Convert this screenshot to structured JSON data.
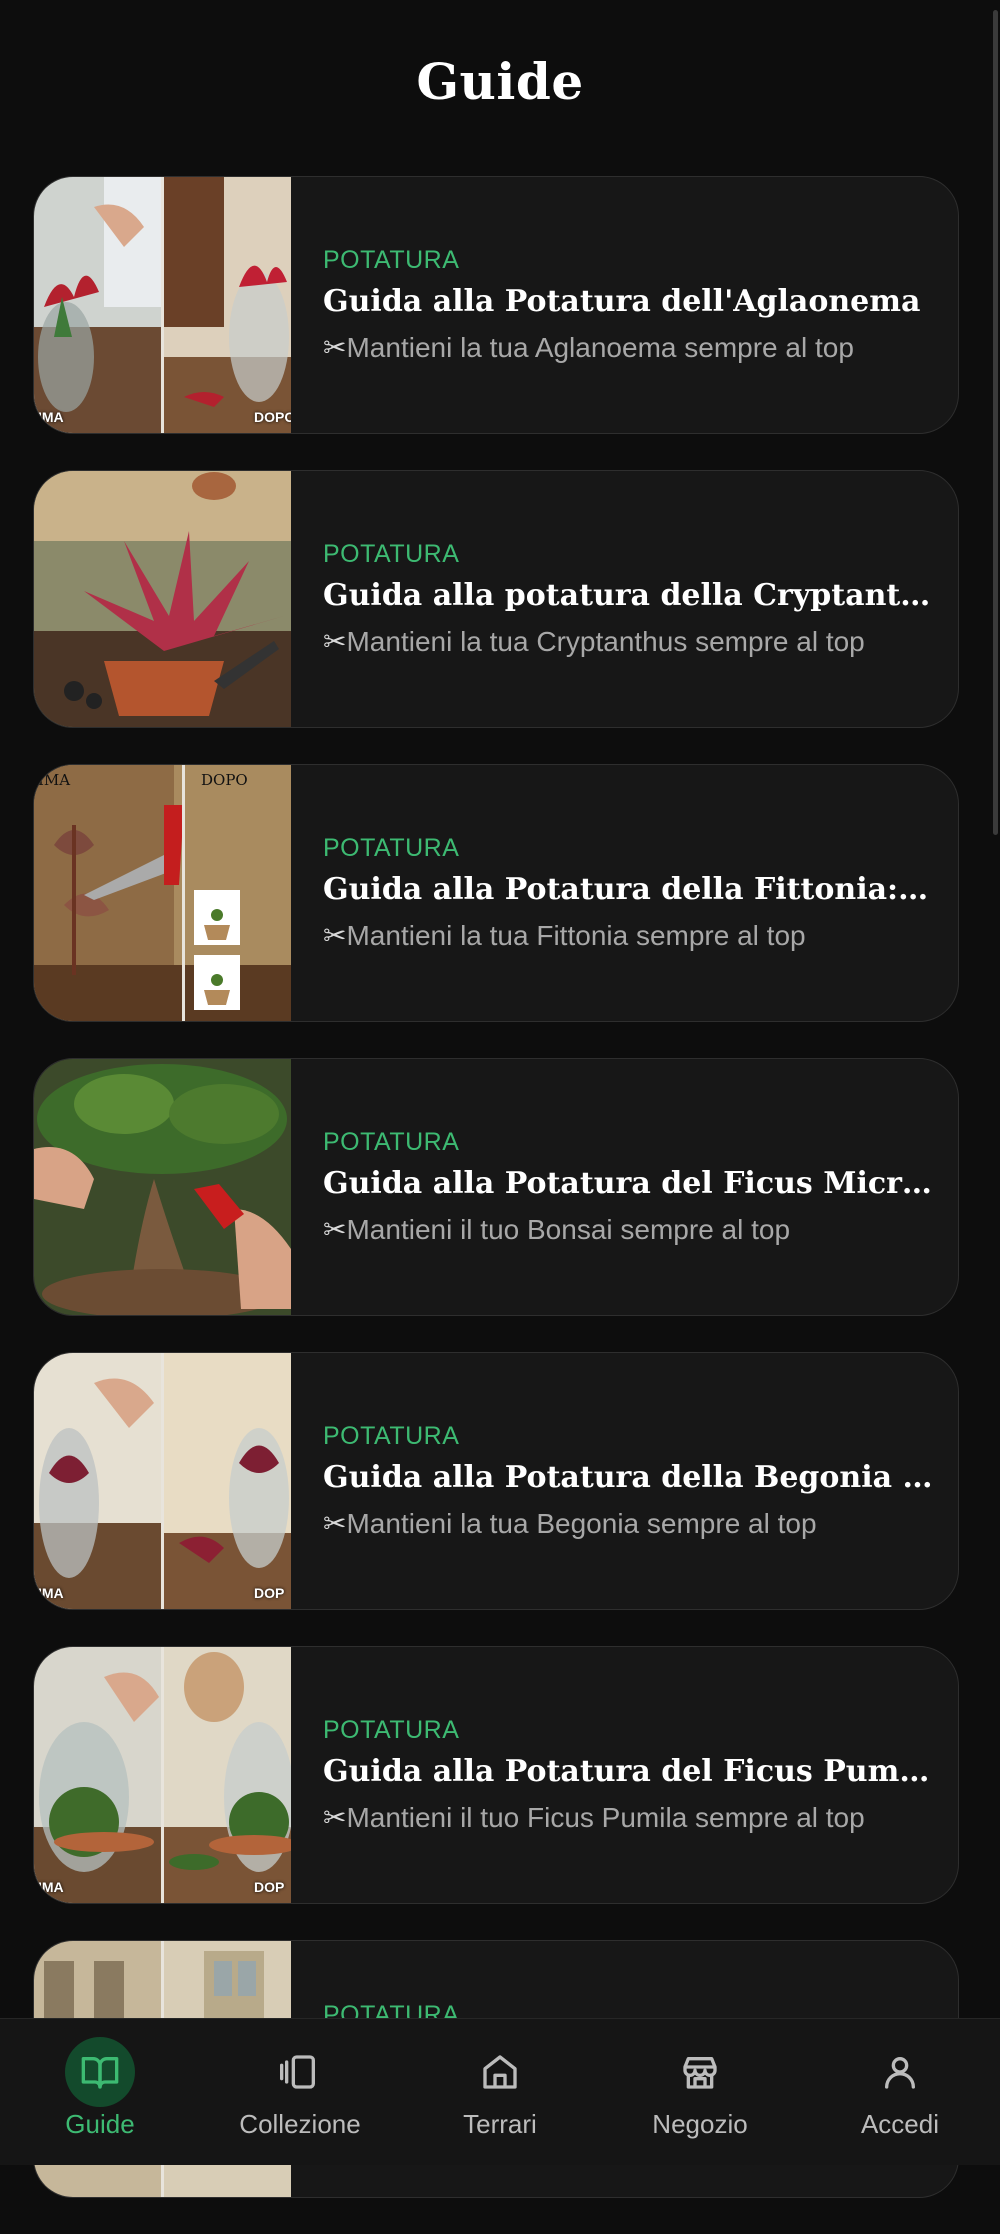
{
  "header": {
    "title": "Guide"
  },
  "colors": {
    "accent": "#3dba72",
    "background": "#0d0d0d",
    "card": "#171717"
  },
  "guides": [
    {
      "category": "POTATURA",
      "title": "Guida alla Potatura dell'Aglaonema",
      "subtitle_icon": "✂",
      "subtitle": "Mantieni la tua Aglanoema sempre al top",
      "thumb_left_tag": "IMA",
      "thumb_right_tag": "DOPO"
    },
    {
      "category": "POTATURA",
      "title": "Guida alla potatura della Cryptanthus",
      "subtitle_icon": "✂",
      "subtitle": "Mantieni la tua Cryptanthus sempre al top"
    },
    {
      "category": "POTATURA",
      "title": "Guida alla Potatura della Fittonia: Ordi...",
      "subtitle_icon": "✂",
      "subtitle": "Mantieni la tua Fittonia sempre al top",
      "thumb_left_tag": "IMA",
      "thumb_right_tag": "DOPO"
    },
    {
      "category": "POTATURA",
      "title": "Guida alla Potatura del Ficus Microcarpa",
      "subtitle_icon": "✂",
      "subtitle": "Mantieni il tuo Bonsai sempre al top"
    },
    {
      "category": "POTATURA",
      "title": "Guida alla Potatura della Begonia Rex",
      "subtitle_icon": "✂",
      "subtitle": "Mantieni la tua Begonia sempre al top",
      "thumb_left_tag": "IMA",
      "thumb_right_tag": "DOP"
    },
    {
      "category": "POTATURA",
      "title": "Guida alla Potatura del Ficus Pumila",
      "subtitle_icon": "✂",
      "subtitle": "Mantieni il tuo Ficus Pumila sempre al top",
      "thumb_left_tag": "IMA",
      "thumb_right_tag": "DOP"
    },
    {
      "category": "POTATURA"
    }
  ],
  "nav": [
    {
      "label": "Guide",
      "icon": "book-open-icon",
      "active": true
    },
    {
      "label": "Collezione",
      "icon": "collection-icon",
      "active": false
    },
    {
      "label": "Terrari",
      "icon": "home-icon",
      "active": false
    },
    {
      "label": "Negozio",
      "icon": "store-icon",
      "active": false
    },
    {
      "label": "Accedi",
      "icon": "user-icon",
      "active": false
    }
  ]
}
